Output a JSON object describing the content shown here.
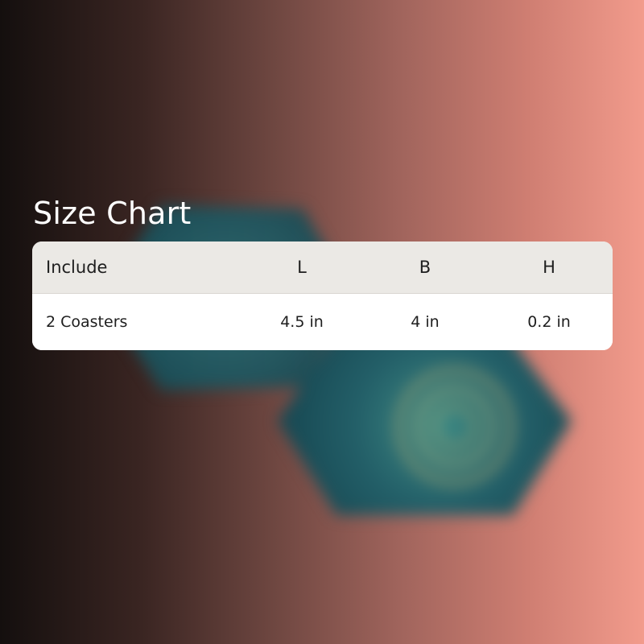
{
  "title": "Size Chart",
  "table": {
    "headers": [
      "Include",
      "L",
      "B",
      "H"
    ],
    "rows": [
      [
        "2 Coasters",
        "4.5 in",
        "4 in",
        "0.2 in"
      ]
    ]
  },
  "colors": {
    "gradient_left": "#140f0e",
    "gradient_right": "#f29b8c",
    "header_bg": "#ebe9e5",
    "row_bg": "#ffffff",
    "coaster_teal": "#1b5660"
  }
}
